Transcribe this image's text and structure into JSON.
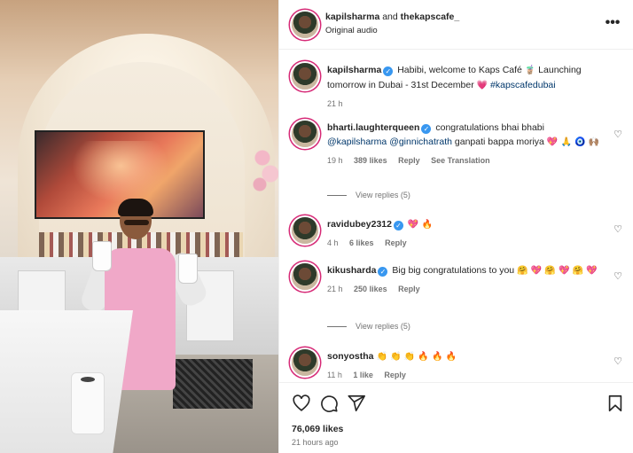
{
  "post": {
    "header": {
      "user1": "kapilsharma",
      "and": "and",
      "user2": "thekapscafe_",
      "subtitle": "Original audio"
    },
    "caption": {
      "username": "kapilsharma",
      "text1": "Habibi, welcome to Kaps Café",
      "emoji1": "🧋",
      "text2": "Launching tomorrow in Dubai - 31st December",
      "emoji2": "💗",
      "hashtag": "#kapscafedubai",
      "time": "21 h"
    },
    "comments": [
      {
        "username": "bharti.laughterqueen",
        "text_a": "congratulations bhai bhabi",
        "mention1": "@kapilsharma",
        "mention2": "@ginnichatrath",
        "text_b": "ganpati bappa moriya",
        "emojis": "💖 🙏 🧿 🙌🏽",
        "time": "19 h",
        "likes": "389 likes",
        "reply": "Reply",
        "translate": "See Translation"
      },
      {
        "username": "ravidubey2312",
        "emojis": "💖 🔥",
        "time": "4 h",
        "likes": "6 likes",
        "reply": "Reply"
      },
      {
        "username": "kikusharda",
        "text_a": "Big big congratulations to you",
        "emojis": "🤗 💖 🤗 💖 🤗 💖",
        "time": "21 h",
        "likes": "250 likes",
        "reply": "Reply"
      },
      {
        "username": "sonyostha",
        "emojis": "👏 👏 👏 🔥 🔥 🔥",
        "time": "11 h",
        "likes": "1 like",
        "reply": "Reply"
      }
    ],
    "view_replies": [
      "View replies (5)",
      "View replies (5)"
    ],
    "more_icon": "more-horizontal-icon",
    "footer": {
      "likes": "76,069 likes",
      "time": "21 hours ago"
    }
  }
}
